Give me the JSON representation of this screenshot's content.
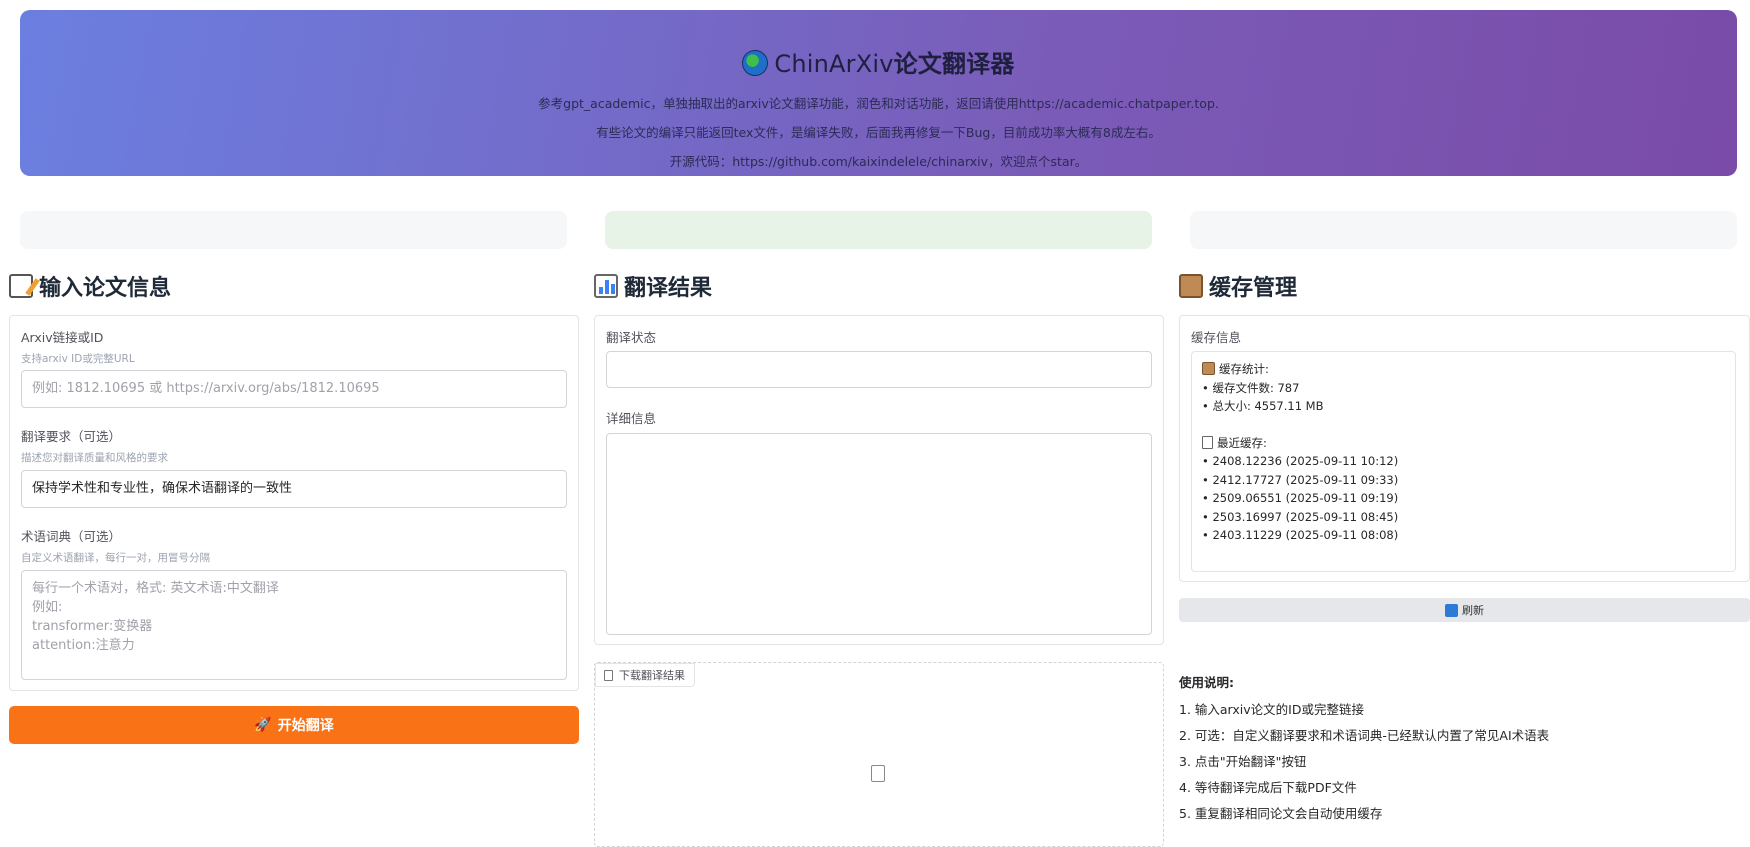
{
  "header": {
    "title_prefix": "ChinArXiv",
    "title_bold": "论文翻译器",
    "line1": "参考gpt_academic，单独抽取出的arxiv论文翻译功能，润色和对话功能，返回请使用https://academic.chatpaper.top.",
    "line2": "有些论文的编译只能返回tex文件，是编译失败，后面我再修复一下Bug，目前成功率大概有8成左右。",
    "line3": "开源代码：https://github.com/kaixindelele/chinarxiv，欢迎点个star。"
  },
  "input_section": {
    "title": "输入论文信息",
    "arxiv_label": "Arxiv链接或ID",
    "arxiv_hint": "支持arxiv ID或完整URL",
    "arxiv_placeholder": "例如: 1812.10695 或 https://arxiv.org/abs/1812.10695",
    "req_label": "翻译要求（可选）",
    "req_hint": "描述您对翻译质量和风格的要求",
    "req_value": "保持学术性和专业性，确保术语翻译的一致性",
    "dict_label": "术语词典（可选）",
    "dict_hint": "自定义术语翻译，每行一对，用冒号分隔",
    "dict_placeholder_lines": [
      "每行一个术语对，格式: 英文术语:中文翻译",
      "例如:",
      "transformer:变换器",
      "attention:注意力"
    ],
    "start_button": "开始翻译"
  },
  "result_section": {
    "title": "翻译结果",
    "status_label": "翻译状态",
    "status_value": "",
    "detail_label": "详细信息",
    "detail_value": "",
    "download_label": "下载翻译结果"
  },
  "cache_section": {
    "title": "缓存管理",
    "info_label": "缓存信息",
    "stats_title": "缓存统计:",
    "file_count": "• 缓存文件数: 787",
    "total_size": "• 总大小: 4557.11 MB",
    "recent_title": "最近缓存:",
    "recent": [
      "• 2408.12236 (2025-09-11 10:12)",
      "• 2412.17727 (2025-09-11 09:33)",
      "• 2509.06551 (2025-09-11 09:19)",
      "• 2503.16997 (2025-09-11 08:45)",
      "• 2403.11229 (2025-09-11 08:08)"
    ],
    "refresh_button": "刷新"
  },
  "usage": {
    "title": "使用说明:",
    "steps": [
      "1. 输入arxiv论文的ID或完整链接",
      "2. 可选：自定义翻译要求和术语词典-已经默认内置了常见AI术语表",
      "3. 点击\"开始翻译\"按钮",
      "4. 等待翻译完成后下载PDF文件",
      "5. 重复翻译相同论文会自动使用缓存"
    ]
  },
  "colors": {
    "accent_orange": "#f97316",
    "header_gradient_start": "#6b7fe0",
    "header_gradient_end": "#7a4ba8",
    "status_strip_green": "#e8f3e8"
  }
}
